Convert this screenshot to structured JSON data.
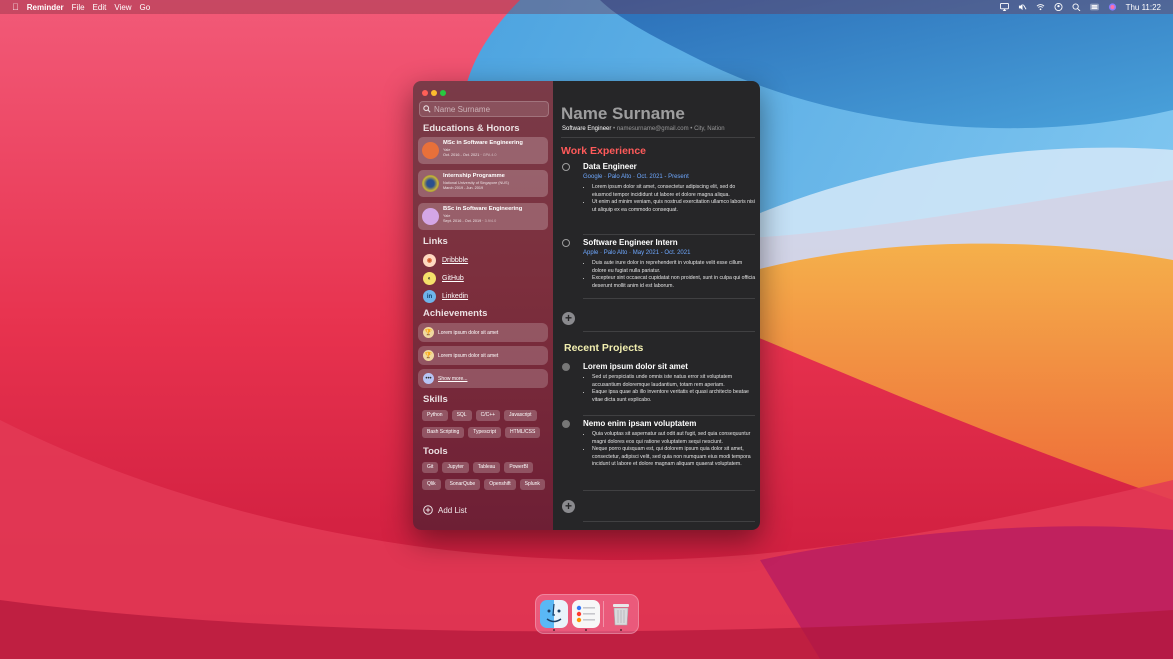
{
  "menubar": {
    "apple_icon": "apple-logo-icon",
    "app_name": "Reminder",
    "menus": [
      "File",
      "Edit",
      "View",
      "Go"
    ],
    "clock": "Thu 11:22",
    "status_icons": [
      "airplay-icon",
      "mute-icon",
      "wifi-icon",
      "user-icon",
      "search-icon",
      "control-center-icon",
      "siri-icon"
    ]
  },
  "sidebar": {
    "search_placeholder": "Name Surname",
    "educations_title": "Educations & Honors",
    "educations": [
      {
        "title": "MSc in Software Engineering",
        "school": "Yale",
        "period": "Oct. 2016 - Oct. 2021",
        "gpa": "GPA 4.0",
        "color": "#e8703a"
      },
      {
        "title": "Internship Programme",
        "school": "National University of Singapore (NUS)",
        "period": "March 2019 - Jun. 2019",
        "gpa": "",
        "color": "#3b6b3a"
      },
      {
        "title": "BSc in Software Engineering",
        "school": "Yale",
        "period": "Sept. 2016 - Oct. 2019",
        "gpa": "3.9/4.0",
        "color": "#d4a6e6"
      }
    ],
    "links_title": "Links",
    "links": [
      {
        "label": "Dribbble",
        "icon": "dribbble-icon",
        "color": "#ffd9c0",
        "glyph": "◉"
      },
      {
        "label": "GitHub",
        "icon": "github-icon",
        "color": "#f5e06a",
        "glyph": "◐"
      },
      {
        "label": "Linkedin",
        "icon": "linkedin-icon",
        "color": "#6fb4ea",
        "glyph": "in"
      }
    ],
    "achievements_title": "Achievements",
    "achievements": [
      {
        "label": "Lorem ipsum dolor sit amet",
        "icon": "trophy-icon"
      },
      {
        "label": "Lorem ipsum dolor sit amet",
        "icon": "trophy-icon"
      }
    ],
    "show_more": "Show more...",
    "skills_title": "Skills",
    "skills_row1": [
      "Python",
      "SQL",
      "C/C++",
      "Javascript"
    ],
    "skills_row2": [
      "Bash Scripting",
      "Typescript",
      "HTML/CSS"
    ],
    "tools_title": "Tools",
    "tools_row1": [
      "Git",
      "Jupyter",
      "Tableau",
      "PowerBI"
    ],
    "tools_row2": [
      "Qlik",
      "SonarQube",
      "Openshift",
      "Splunk"
    ],
    "add_list": "Add List"
  },
  "main": {
    "name": "Name Surname",
    "role": "Software Engineer",
    "email": "namesurname@gmail.com",
    "location": "City, Nation",
    "work_title": "Work Experience",
    "work_color": "#ff5a5a",
    "jobs": [
      {
        "title": "Data Engineer",
        "company": "Google",
        "place": "Palo Alto",
        "period": "Oct. 2021 - Present",
        "bullets": [
          "Lorem ipsum dolor sit amet, consectetur adipiscing elit, sed do eiusmod tempor incididunt ut labore et dolore magna aliqua.",
          "Ut enim ad minim veniam, quis nostrud exercitation ullamco laboris nisi ut aliquip ex ea commodo consequat."
        ]
      },
      {
        "title": "Software Engineer Intern",
        "company": "Apple",
        "place": "Palo Alto",
        "period": "May 2021 - Oct. 2021",
        "bullets": [
          "Duis aute irure dolor in reprehenderit in voluptate velit esse cillum dolore eu fugiat nulla pariatur.",
          "Excepteur sint occaecat cupidatat non proident, sunt in culpa qui officia deserunt mollit anim id est laborum."
        ]
      }
    ],
    "projects_title": "Recent Projects",
    "projects_color": "#f2efb0",
    "projects": [
      {
        "title": "Lorem ipsum dolor sit amet",
        "bullets": [
          "Sed ut perspiciatis unde omnis iste natus error sit voluptatem accusantium doloremque laudantium, totam rem aperiam.",
          "Eaque ipsa quae ab illo inventore veritatis et quasi architecto beatae vitae dicta sunt explicabo."
        ]
      },
      {
        "title": "Nemo enim ipsam voluptatem",
        "bullets": [
          "Quia voluptas sit aspernatur aut odit aut fugit, sed quia consequuntur magni dolores eos qui ratione voluptatem sequi nesciunt.",
          "Neque porro quisquam est, qui dolorem ipsum quia dolor sit amet, consectetur, adipisci velit, sed quia non numquam eius modi tempora incidunt ut labore et dolore magnam aliquam quaerat voluptatem."
        ]
      }
    ]
  },
  "dock": {
    "items": [
      "finder-icon",
      "reminders-icon",
      "trash-icon"
    ]
  }
}
